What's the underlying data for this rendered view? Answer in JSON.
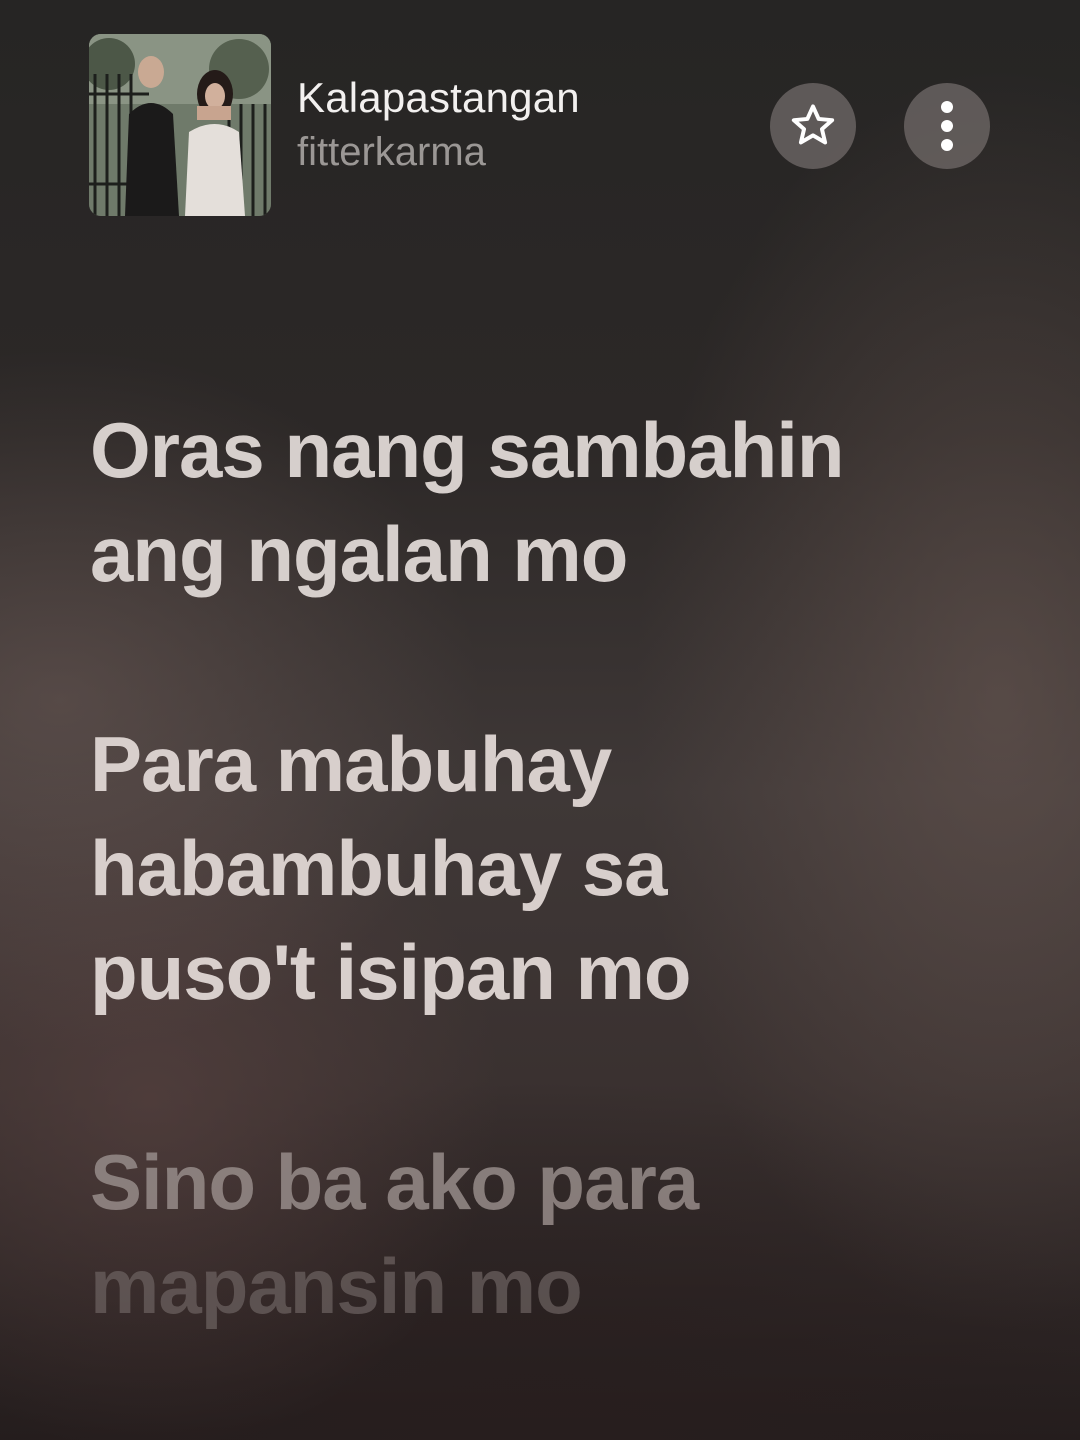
{
  "now_playing": {
    "title": "Kalapastangan",
    "artist": "fitterkarma"
  },
  "actions": {
    "favorite_icon": "star-icon",
    "more_icon": "more-vertical-icon"
  },
  "lyrics": {
    "verses": [
      {
        "lines": [
          "Oras nang sambahin",
          "ang ngalan mo"
        ]
      },
      {
        "lines": [
          "Para mabuhay",
          "habambuhay sa",
          "puso't isipan mo"
        ]
      },
      {
        "lines": [
          "Sino ba ako para",
          "mapansin mo"
        ]
      }
    ]
  },
  "colors": {
    "lyric_active": "#d6cfcc",
    "lyric_upcoming": "#968c8a",
    "button_bg": "#6e6866"
  }
}
